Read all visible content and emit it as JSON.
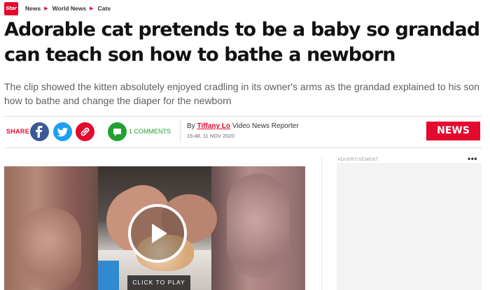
{
  "site": {
    "logo_text": "Star"
  },
  "breadcrumb": [
    "News",
    "World News",
    "Cats"
  ],
  "article": {
    "headline": "Adorable cat pretends to be a baby so grandad can teach son how to bathe a newborn",
    "standfirst": "The clip showed the kitten absolutely enjoyed cradling in its owner's arms as the grandad explained to his son how to bathe and change the diaper for the newborn"
  },
  "share": {
    "label": "SHARE",
    "comments_label": "1 COMMENTS"
  },
  "byline": {
    "prefix": "By",
    "author": "Tiffany Lo",
    "role": "Video News Reporter",
    "date": "15:48, 11 NOV 2020"
  },
  "badge": "NEWS",
  "video": {
    "cta": "CLICK TO PLAY"
  },
  "ad": {
    "label": "ADVERTISEMENT",
    "menu": "•••"
  },
  "colors": {
    "brand": "#e4092e",
    "facebook": "#3b5998",
    "twitter": "#1da1f2",
    "comments": "#22a033"
  }
}
